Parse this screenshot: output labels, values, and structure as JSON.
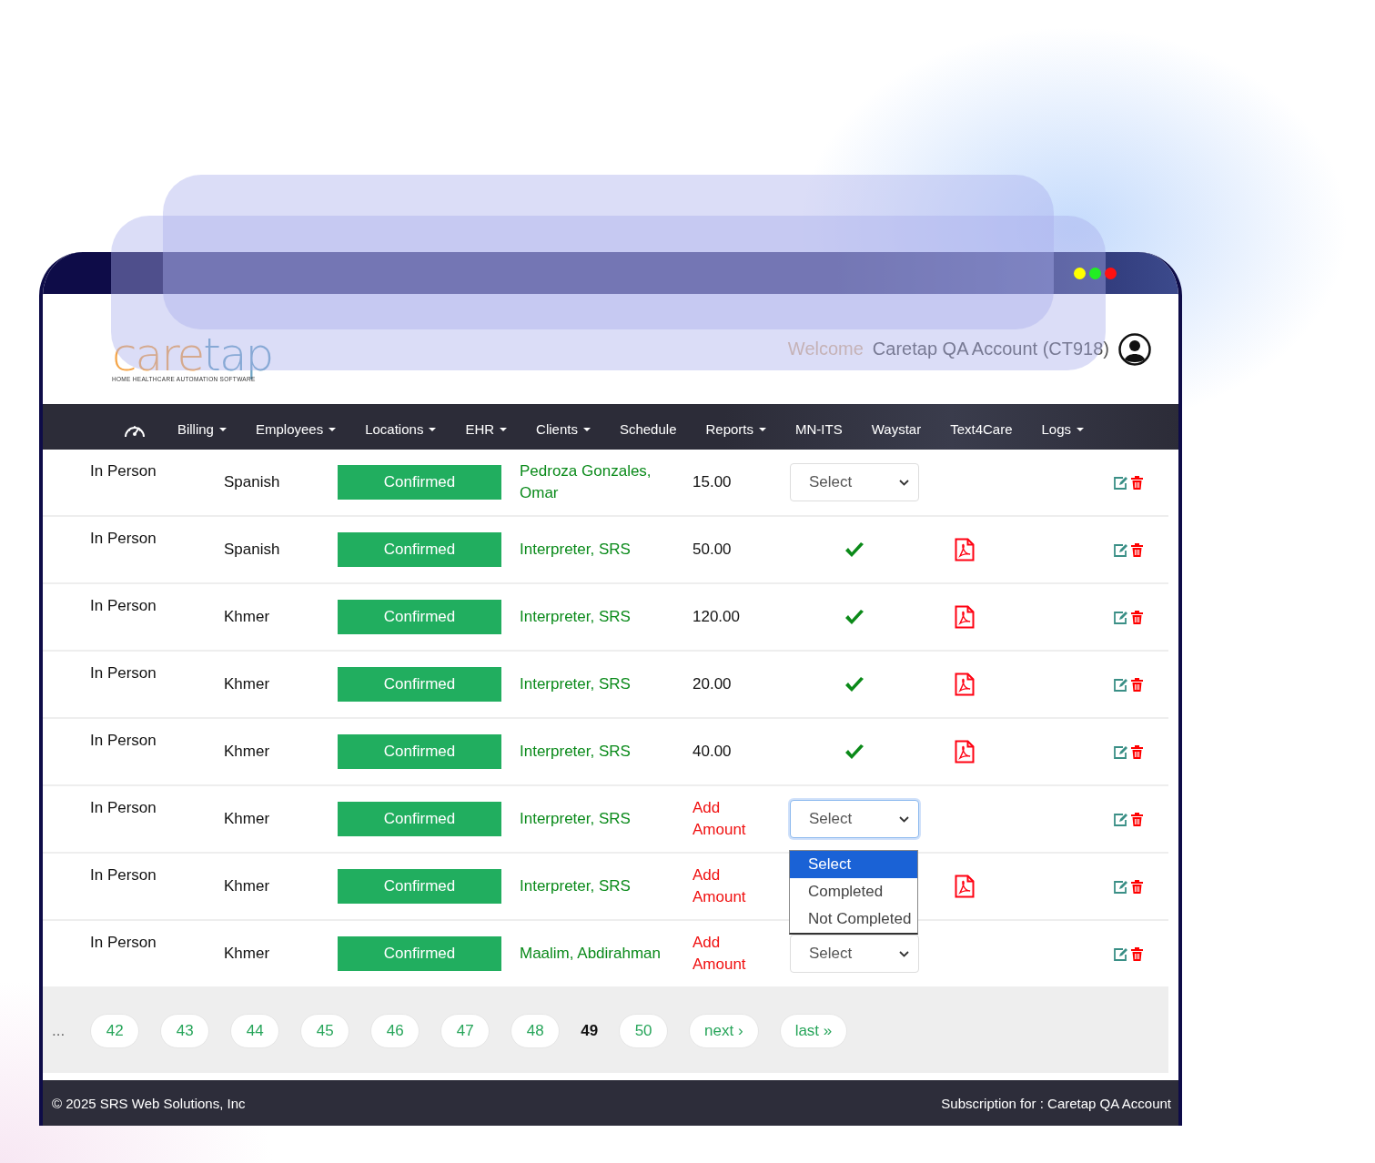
{
  "window_controls": [
    {
      "color": "#ffff00"
    },
    {
      "color": "#22ee22"
    },
    {
      "color": "#ff1111"
    }
  ],
  "header": {
    "logo": {
      "parts": [
        "care",
        "tap"
      ],
      "tagline": "HOME HEALTHCARE AUTOMATION SOFTWARE"
    },
    "welcome": "Welcome",
    "account": "Caretap QA Account (CT918)"
  },
  "nav": [
    {
      "label": "Billing",
      "dropdown": true
    },
    {
      "label": "Employees",
      "dropdown": true
    },
    {
      "label": "Locations",
      "dropdown": true
    },
    {
      "label": "EHR",
      "dropdown": true
    },
    {
      "label": "Clients",
      "dropdown": true
    },
    {
      "label": "Schedule",
      "dropdown": false
    },
    {
      "label": "Reports",
      "dropdown": true
    },
    {
      "label": "MN-ITS",
      "dropdown": false
    },
    {
      "label": "Waystar",
      "dropdown": false
    },
    {
      "label": "Text4Care",
      "dropdown": false
    },
    {
      "label": "Logs",
      "dropdown": true
    }
  ],
  "rows": [
    {
      "type": "In Person",
      "language": "Spanish",
      "status": "Confirmed",
      "interpreter": "Pedroza Gonzales, Omar",
      "amount": {
        "kind": "value",
        "text": "15.00"
      },
      "completion": {
        "kind": "select",
        "value": "Select",
        "focused": false
      },
      "pdf": false
    },
    {
      "type": "In Person",
      "language": "Spanish",
      "status": "Confirmed",
      "interpreter": "Interpreter, SRS",
      "amount": {
        "kind": "value",
        "text": "50.00"
      },
      "completion": {
        "kind": "check"
      },
      "pdf": true
    },
    {
      "type": "In Person",
      "language": "Khmer",
      "status": "Confirmed",
      "interpreter": "Interpreter, SRS",
      "amount": {
        "kind": "value",
        "text": "120.00"
      },
      "completion": {
        "kind": "check"
      },
      "pdf": true
    },
    {
      "type": "In Person",
      "language": "Khmer",
      "status": "Confirmed",
      "interpreter": "Interpreter, SRS",
      "amount": {
        "kind": "value",
        "text": "20.00"
      },
      "completion": {
        "kind": "check"
      },
      "pdf": true
    },
    {
      "type": "In Person",
      "language": "Khmer",
      "status": "Confirmed",
      "interpreter": "Interpreter, SRS",
      "amount": {
        "kind": "value",
        "text": "40.00"
      },
      "completion": {
        "kind": "check"
      },
      "pdf": true
    },
    {
      "type": "In Person",
      "language": "Khmer",
      "status": "Confirmed",
      "interpreter": "Interpreter, SRS",
      "amount": {
        "kind": "add",
        "text": "Add Amount"
      },
      "completion": {
        "kind": "select",
        "value": "Select",
        "focused": true,
        "open": true,
        "options": [
          {
            "label": "Select",
            "selected": true
          },
          {
            "label": "Completed",
            "selected": false
          },
          {
            "label": "Not Completed",
            "selected": false
          }
        ]
      },
      "pdf": false
    },
    {
      "type": "In Person",
      "language": "Khmer",
      "status": "Confirmed",
      "interpreter": "Interpreter, SRS",
      "amount": {
        "kind": "add",
        "text": "Add Amount"
      },
      "pdf": true
    },
    {
      "type": "In Person",
      "language": "Khmer",
      "status": "Confirmed",
      "interpreter": "Maalim, Abdirahman",
      "amount": {
        "kind": "add",
        "text": "Add Amount"
      },
      "completion": {
        "kind": "select",
        "value": "Select",
        "focused": false
      },
      "pdf": false
    }
  ],
  "pagination": {
    "ellipsis": "...",
    "pages": [
      {
        "label": "42",
        "current": false
      },
      {
        "label": "43",
        "current": false
      },
      {
        "label": "44",
        "current": false
      },
      {
        "label": "45",
        "current": false
      },
      {
        "label": "46",
        "current": false
      },
      {
        "label": "47",
        "current": false
      },
      {
        "label": "48",
        "current": false
      },
      {
        "label": "49",
        "current": true
      },
      {
        "label": "50",
        "current": false
      },
      {
        "label": "next ›",
        "current": false
      },
      {
        "label": "last »",
        "current": false
      }
    ]
  },
  "footer": {
    "copyright": "© 2025 SRS Web Solutions, Inc",
    "subscription": "Subscription for : Caretap QA Account"
  }
}
